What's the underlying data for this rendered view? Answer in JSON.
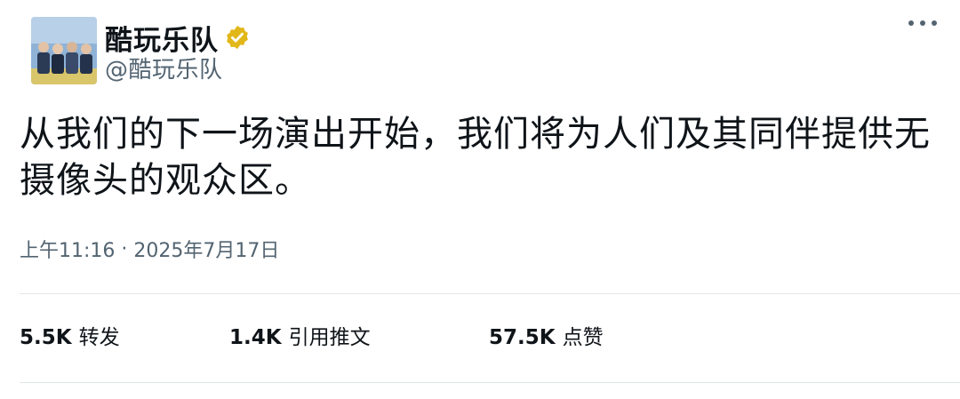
{
  "author": {
    "display_name": "酷玩乐队",
    "handle": "@酷玩乐队",
    "verified": true,
    "verified_color": "#e2b719",
    "avatar_icon": "band-photo-avatar"
  },
  "more_icon": "more-options-icon",
  "tweet": {
    "text": "从我们的下一场演出开始，我们将为人们及其同伴提供无摄像头的观众区。",
    "time": "上午11:16",
    "separator": "·",
    "date": "2025年7月17日"
  },
  "stats": {
    "retweets": {
      "count": "5.5K",
      "label": "转发"
    },
    "quotes": {
      "count": "1.4K",
      "label": "引用推文"
    },
    "likes": {
      "count": "57.5K",
      "label": "点赞"
    }
  },
  "colors": {
    "text_primary": "#0f1419",
    "text_secondary": "#536471",
    "divider": "#e1e6ea"
  }
}
